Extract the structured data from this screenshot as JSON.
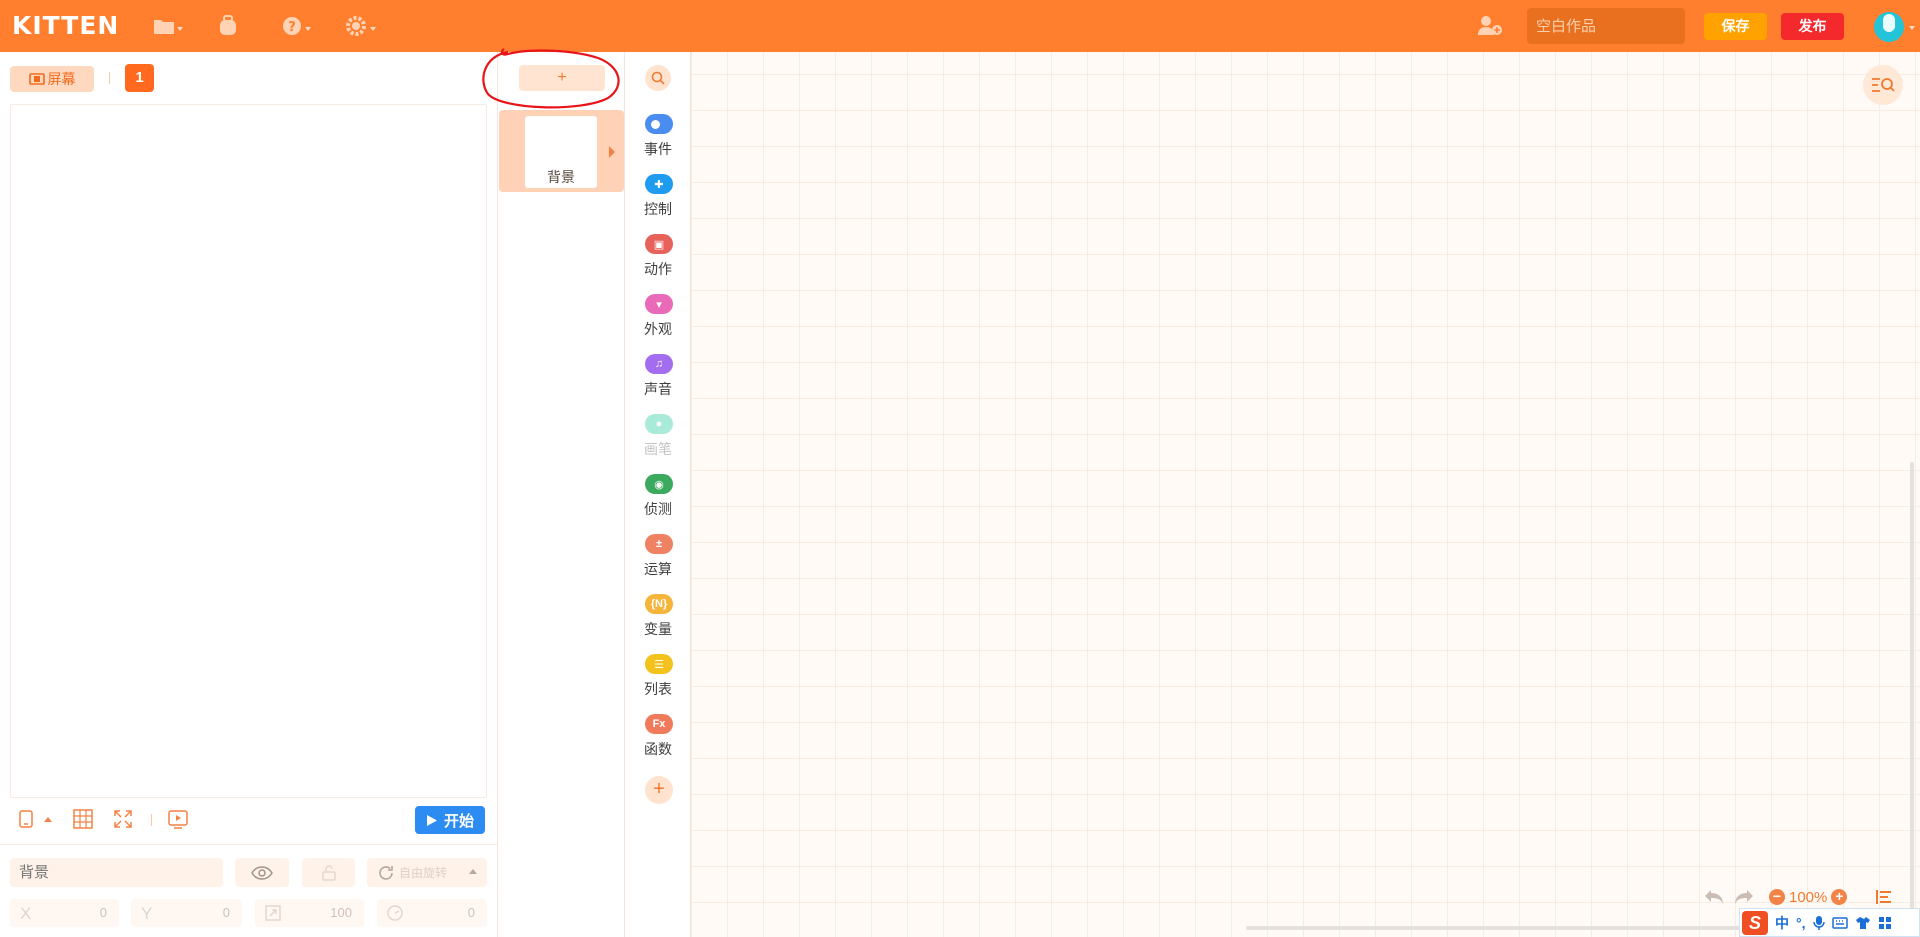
{
  "app": {
    "logo": "KITTEN"
  },
  "header": {
    "title_placeholder": "空白作品",
    "save_label": "保存",
    "publish_label": "发布",
    "icons": [
      "folder-icon",
      "backpack-icon",
      "help-icon",
      "settings-icon",
      "add-user-icon"
    ]
  },
  "stage": {
    "screen_label": "屏幕",
    "screen_number": "1",
    "start_label": "开始",
    "sprite_name_placeholder": "背景",
    "rotation_mode": "自由旋转",
    "coords": [
      {
        "key": "X",
        "value": "0"
      },
      {
        "key": "Y",
        "value": "0"
      },
      {
        "key": "size",
        "value": "100"
      },
      {
        "key": "direction",
        "value": "0"
      }
    ]
  },
  "sprites": {
    "add_label": "+",
    "items": [
      {
        "label": "背景"
      }
    ]
  },
  "categories": [
    {
      "label": "事件",
      "color": "#4a8cf0",
      "icon": "toggle-icon"
    },
    {
      "label": "控制",
      "color": "#1f9cf0",
      "icon": "gamepad-icon"
    },
    {
      "label": "动作",
      "color": "#e8625c",
      "icon": "motion-icon"
    },
    {
      "label": "外观",
      "color": "#e86ab8",
      "icon": "shirt-icon"
    },
    {
      "label": "声音",
      "color": "#a36df0",
      "icon": "music-icon"
    },
    {
      "label": "画笔",
      "color": "#a9ead8",
      "icon": "pen-icon",
      "disabled": true
    },
    {
      "label": "侦测",
      "color": "#3caa5e",
      "icon": "sensor-icon"
    },
    {
      "label": "运算",
      "color": "#f08264",
      "icon": "math-icon"
    },
    {
      "label": "变量",
      "color": "#f5b43a",
      "icon": "variable-icon",
      "glyph": "{N}"
    },
    {
      "label": "列表",
      "color": "#f3c21d",
      "icon": "list-icon"
    },
    {
      "label": "函数",
      "color": "#f07a5c",
      "icon": "function-icon",
      "glyph": "Fx"
    }
  ],
  "workspace": {
    "zoom": "100%",
    "ime": {
      "mode": "中",
      "punct": "°,"
    }
  }
}
